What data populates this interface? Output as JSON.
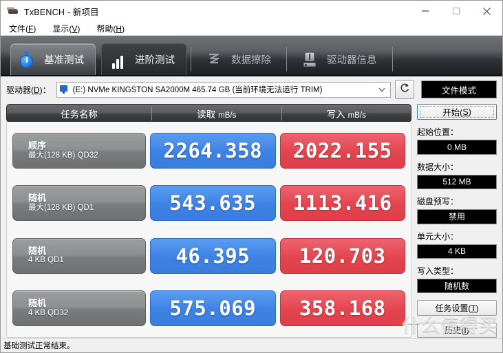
{
  "window": {
    "title": "TxBENCH - 新项目",
    "icon": "app-icon",
    "controls": {
      "minimize": "—",
      "maximize": "▢",
      "close": "✕"
    }
  },
  "menubar": {
    "items": [
      {
        "label": "文件",
        "accel": "F"
      },
      {
        "label": "显示",
        "accel": "V"
      },
      {
        "label": "帮助",
        "accel": "H"
      }
    ]
  },
  "tabs": [
    {
      "label": "基准测试",
      "icon": "stopwatch-icon",
      "active": true
    },
    {
      "label": "进阶测试",
      "icon": "bar-chart-icon",
      "active": false
    },
    {
      "label": "数据擦除",
      "icon": "erase-icon",
      "active": false
    },
    {
      "label": "驱动器信息",
      "icon": "drive-info-icon",
      "active": false
    }
  ],
  "drive_row": {
    "label": "驱动器(D)：",
    "label_text": "驱动器(",
    "label_accel": "D",
    "label_tail": ")：",
    "selected": "(E:) NVMe KINGSTON SA2000M  465.74 GB (当前环境无法运行 TRIM)",
    "refresh_icon": "refresh-icon",
    "mode_button": "文件模式"
  },
  "table": {
    "headers": {
      "task": "任务名称",
      "read": "读取",
      "read_unit": "mB/s",
      "write": "写入",
      "write_unit": "mB/s"
    },
    "rows": [
      {
        "name_line1": "顺序",
        "name_line2": "最大(128 KB) QD32",
        "read": "2264.358",
        "write": "2022.155"
      },
      {
        "name_line1": "随机",
        "name_line2": "最大(128 KB) QD1",
        "read": "543.635",
        "write": "1113.416"
      },
      {
        "name_line1": "随机",
        "name_line2": "4 KB QD1",
        "read": "46.395",
        "write": "120.703"
      },
      {
        "name_line1": "随机",
        "name_line2": "4 KB QD32",
        "read": "575.069",
        "write": "358.168"
      }
    ]
  },
  "sidebar": {
    "start_button": {
      "text": "开始(",
      "accel": "S",
      "tail": ")"
    },
    "fields": [
      {
        "label": "起始位置：",
        "value": "0 MB"
      },
      {
        "label": "数据大小：",
        "value": "512 MB"
      },
      {
        "label": "磁盘预写：",
        "value": "禁用"
      },
      {
        "label": "单元大小：",
        "value": "4 KB"
      },
      {
        "label": "写入类型：",
        "value": "随机数"
      }
    ],
    "task_settings": {
      "text": "任务设置(",
      "accel": "T",
      "tail": ")"
    },
    "history": {
      "text": "历史(",
      "accel": "I",
      "tail": ")"
    }
  },
  "statusbar": {
    "text": "基础测试正常结束。"
  },
  "watermark": {
    "text": "什么值得买"
  },
  "colors": {
    "read_chip": "#3d82e4",
    "write_chip": "#e2454f",
    "task_chip": "#8d9091",
    "header_dark": "#3f4346",
    "accent_blue": "#2f7fd8"
  }
}
